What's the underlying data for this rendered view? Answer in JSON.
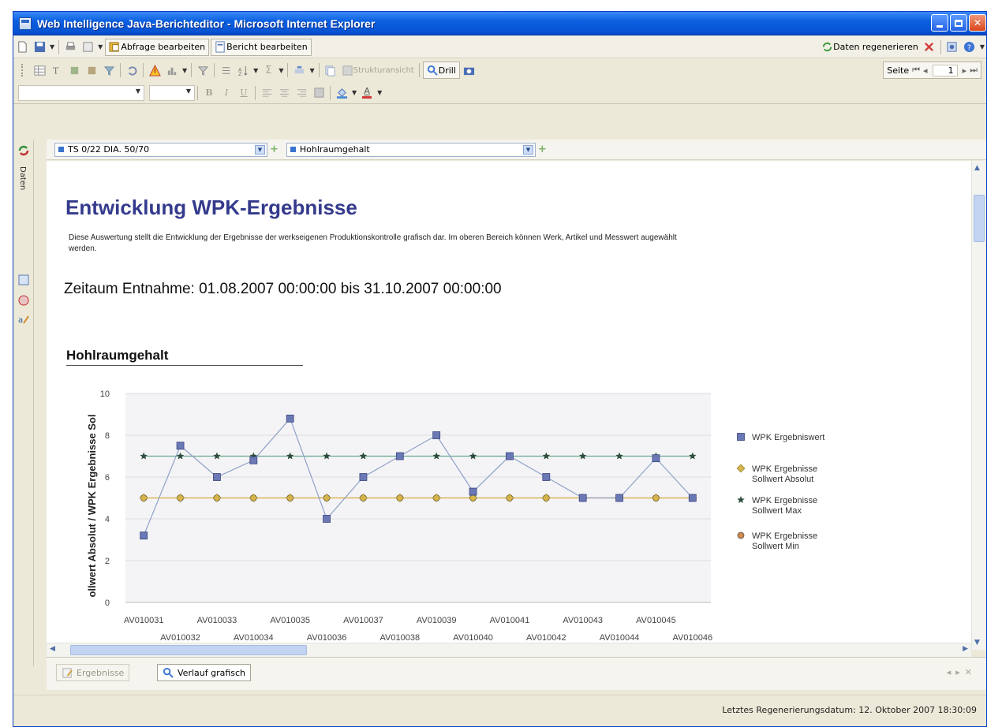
{
  "window": {
    "title": "Web Intelligence Java-Berichteditor - Microsoft Internet Explorer"
  },
  "toolbar1": {
    "edit_query": "Abfrage bearbeiten",
    "edit_report": "Bericht bearbeiten",
    "refresh_data": "Daten regenerieren"
  },
  "toolbar2": {
    "structure_view": "Strukturansicht",
    "drill": "Drill",
    "page_label": "Seite",
    "page_number": "1"
  },
  "toolbar3": {
    "bold": "B",
    "italic": "I",
    "underline": "U",
    "font_color": "A"
  },
  "selectors": {
    "product": "TS 0/22 DIA. 50/70",
    "measure": "Hohlraumgehalt"
  },
  "sidebar": {
    "data_tab": "Daten"
  },
  "report": {
    "title": "Entwicklung WPK-Ergebnisse",
    "description": "Diese Auswertung stellt die Entwicklung der Ergebnisse der werkseigenen Produktionskontrolle grafisch dar. Im oberen Bereich können Werk, Artikel und Messwert augewählt werden.",
    "period": "Zeitaum Entnahme: 01.08.2007 00:00:00 bis 31.10.2007 00:00:00",
    "chart_heading": "Hohlraumgehalt"
  },
  "chart_data": {
    "type": "line",
    "ylabel": "ollwert Absolut / WPK Ergebnisse Sol",
    "ylim": [
      0,
      10
    ],
    "yticks": [
      "0",
      "2",
      "4",
      "6",
      "8",
      "10"
    ],
    "grid": true,
    "legend_position": "right",
    "categories": [
      "AV010031",
      "AV010032",
      "AV010033",
      "AV010034",
      "AV010035",
      "AV010036",
      "AV010037",
      "AV010038",
      "AV010039",
      "AV010040",
      "AV010041",
      "AV010042",
      "AV010043",
      "AV010044",
      "AV010045",
      "AV010046"
    ],
    "series": [
      {
        "name": "WPK Ergebniswert",
        "marker": "square",
        "color": "#6a78b5",
        "values": [
          3.2,
          7.5,
          6.0,
          6.8,
          8.8,
          4.0,
          6.0,
          7.0,
          8.0,
          5.3,
          7.0,
          6.0,
          5.0,
          5.0,
          6.9,
          5.0
        ]
      },
      {
        "name": "WPK Ergebnisse Sollwert Absolut",
        "marker": "diamond",
        "color": "#d6b44c",
        "values": [
          5,
          5,
          5,
          5,
          5,
          5,
          5,
          5,
          5,
          5,
          5,
          5,
          5,
          5,
          5,
          5
        ]
      },
      {
        "name": "WPK Ergebnisse Sollwert Max",
        "marker": "star",
        "color": "#2e4d3c",
        "values": [
          7,
          7,
          7,
          7,
          7,
          7,
          7,
          7,
          7,
          7,
          7,
          7,
          7,
          7,
          7,
          7
        ]
      },
      {
        "name": "WPK Ergebnisse Sollwert Min",
        "marker": "circle",
        "color": "#d08a4a",
        "values": [
          5,
          5,
          5,
          5,
          5,
          5,
          5,
          5,
          5,
          5,
          5,
          5,
          5,
          5,
          5,
          5
        ]
      }
    ]
  },
  "tabs": {
    "results": "Ergebnisse",
    "trend_chart": "Verlauf grafisch"
  },
  "status": {
    "last_refresh": "Letztes Regenerierungsdatum: 12. Oktober 2007 18:30:09"
  },
  "colors": {
    "title_bar": "#0a5fe0",
    "report_title": "#343a8c"
  }
}
